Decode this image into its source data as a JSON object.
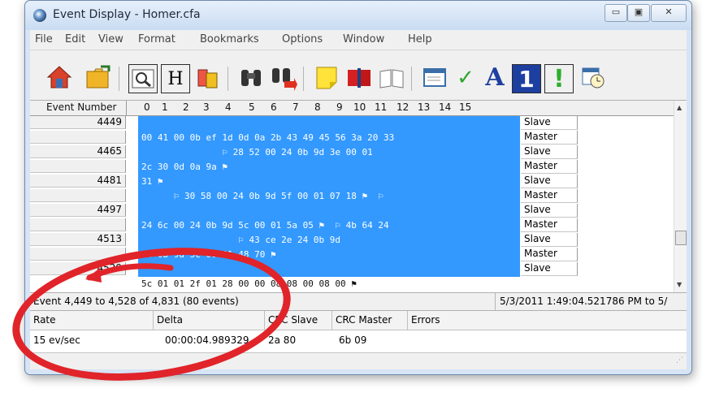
{
  "window": {
    "title": "Event Display - Homer.cfa"
  },
  "window_buttons": {
    "minimize": "▭",
    "maximize": "▣",
    "close": "✕"
  },
  "menu": [
    "File",
    "Edit",
    "View",
    "Format",
    "Bookmarks",
    "Options",
    "Window",
    "Help"
  ],
  "toolbar_icons": [
    "home-icon",
    "open-folder-icon",
    "find-icon",
    "header-icon",
    "format-icon",
    "binoculars-icon",
    "find-next-icon",
    "bookmark-note-icon",
    "bookmark-book-icon",
    "open-book-icon",
    "window-icon",
    "checkmark-icon",
    "font-icon",
    "number-one-icon",
    "exclamation-icon",
    "calendar-clock-icon"
  ],
  "toolbar_glyphs": {
    "font": "A",
    "one": "1",
    "exclaim": "!"
  },
  "grid": {
    "event_number_header": "Event Number",
    "column_headers": [
      "0",
      "1",
      "2",
      "3",
      "4",
      "5",
      "6",
      "7",
      "8",
      "9",
      "10",
      "11",
      "12",
      "13",
      "14",
      "15"
    ],
    "row_numbers": [
      "4449",
      "",
      "4465",
      "",
      "4481",
      "",
      "4497",
      "",
      "4513",
      "",
      "4529"
    ],
    "hex_lines": [
      "",
      "00 41 00 0b ef 1d 0d 0a 2b 43 49 45 56 3a 20 33",
      "               ⚐ 28 52 00 24 0b 9d 3e 00 01",
      "2c 30 0d 0a 9a ⚑",
      "31 ⚑",
      "      ⚐ 30 58 00 24 0b 9d 5f 00 01 07 18 ⚑  ⚐",
      "",
      "24 6c 00 24 0b 9d 5c 00 01 5a 05 ⚑  ⚐ 4b 64 24",
      "                  ⚐ 43 ce 2e 24 0b 9d",
      "24 0b 9d 5c 00 01 48 70 ⚑"
    ],
    "last_row_hex": "5c 01 01 2f 01 28 00 00 08 08 00 08 00 ⚑",
    "roles": [
      "Slave",
      "Master",
      "Slave",
      "Master",
      "Slave",
      "Master",
      "Slave",
      "Master",
      "Slave",
      "Master",
      "Slave"
    ]
  },
  "status": {
    "left": "Event 4,449 to 4,528 of 4,831 (80 events)",
    "right": "5/3/2011 1:49:04.521786 PM to 5/"
  },
  "info_table": {
    "headers": [
      "Rate",
      "Delta",
      "CRC Slave",
      "CRC Master",
      "Errors"
    ],
    "values": [
      "15 ev/sec",
      "00:00:04.989329",
      "2a 80",
      "6b 09",
      ""
    ]
  },
  "colors": {
    "selection": "#3399ff",
    "highlight_circle": "#e0242a"
  }
}
